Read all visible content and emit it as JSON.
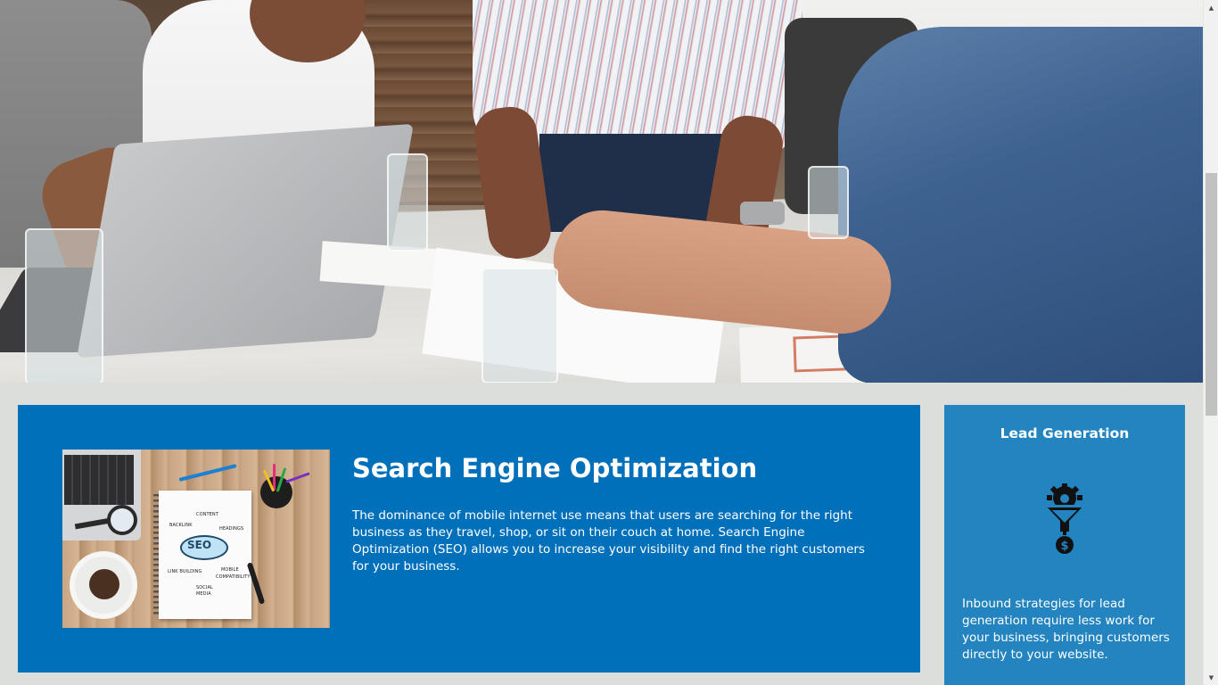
{
  "hero": {
    "image_alt": "Business team meeting around a table with laptop and documents"
  },
  "seo": {
    "title": "Search Engine Optimization",
    "description": "The dominance of mobile internet use means that users are searching for the right business as they travel, shop, or sit on their couch at home. Search Engine Optimization (SEO) allows you to increase your visibility and find the right customers for your business.",
    "image": {
      "cloud_text": "SEO",
      "labels": [
        "CONTENT",
        "BACKLINK",
        "HEADINGS",
        "LINK BUILDING",
        "MOBILE",
        "COMPATIBILITY",
        "SOCIAL",
        "MEDIA"
      ]
    },
    "background_color": "#0070bb"
  },
  "lead": {
    "title": "Lead Generation",
    "icon": "funnel-gear-dollar-icon",
    "description": "Inbound strategies for lead generation require less work for your business, bringing customers directly to your website.",
    "background_color": "#2384c0"
  },
  "scrollbar": {
    "up_glyph": "▲",
    "down_glyph": "▼"
  }
}
